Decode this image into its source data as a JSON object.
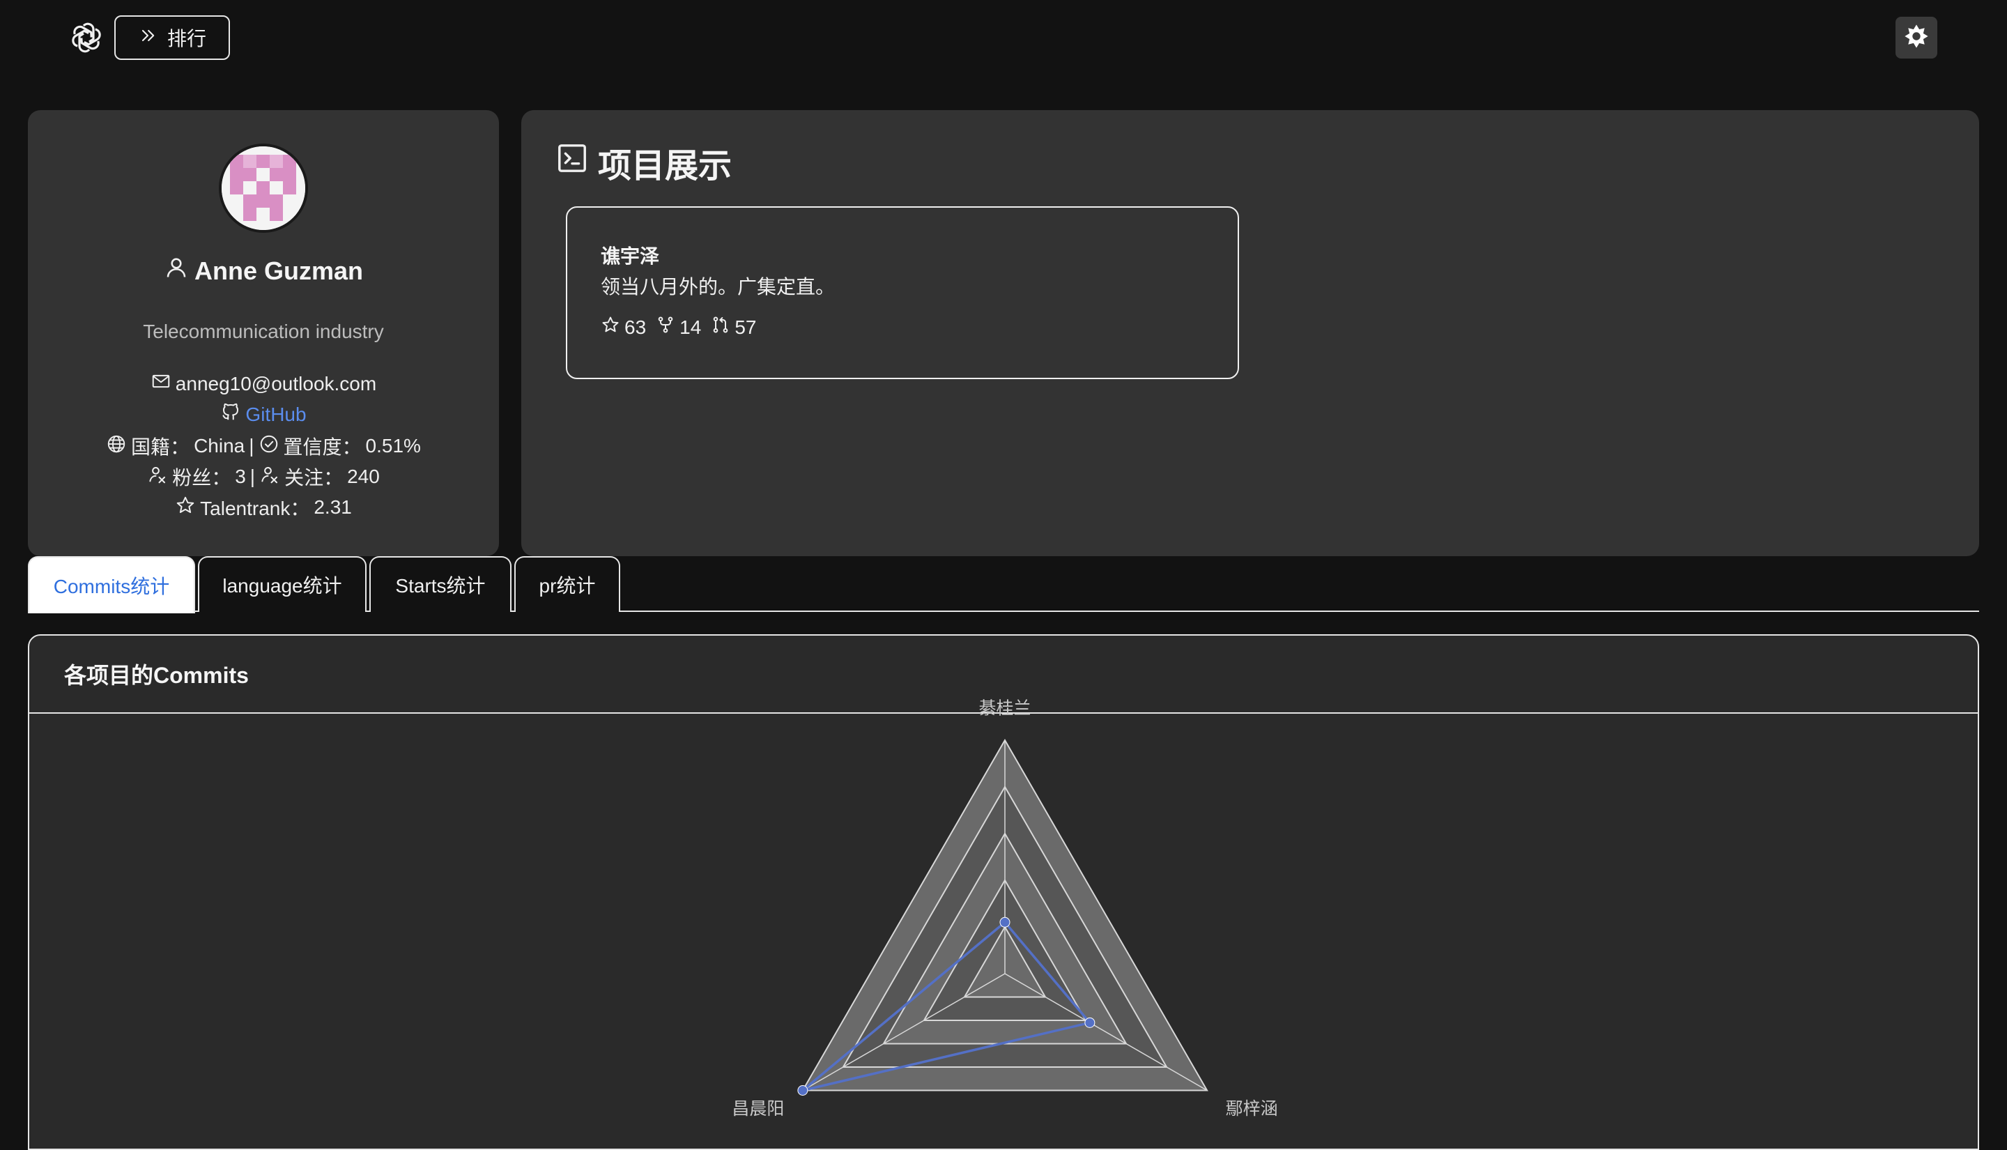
{
  "topbar": {
    "logo_icon": "openai-logo-icon",
    "rank_label": "排行",
    "rank_icon": "chevrons-right-icon",
    "theme_icon": "sun-icon"
  },
  "profile": {
    "name": "Anne Guzman",
    "company": "Telecommunication industry",
    "email": "anneg10@outlook.com",
    "github_label": "GitHub",
    "nationality_label": "国籍：",
    "nationality": "China",
    "separator": "|",
    "confidence_label": "置信度：",
    "confidence": "0.51%",
    "followers_label": "粉丝：",
    "followers": "3",
    "following_label": "关注：",
    "following": "240",
    "talentrank_label": "Talentrank：",
    "talentrank": "2.31",
    "link_color": "#5b8dee"
  },
  "projects": {
    "title": "项目展示",
    "items": [
      {
        "name": "谯宇泽",
        "description": "领当八月外的。广集定直。",
        "stars": "63",
        "forks": "14",
        "prs": "57"
      }
    ]
  },
  "tabs": [
    {
      "label": "Commits统计",
      "active": true
    },
    {
      "label": "language统计",
      "active": false
    },
    {
      "label": "Starts统计",
      "active": false
    },
    {
      "label": "pr统计",
      "active": false
    }
  ],
  "chart_panel": {
    "title": "各项目的Commits"
  },
  "chart_data": {
    "type": "radar",
    "indicators": [
      "綦桂兰",
      "鄢梓涵",
      "昌晨阳"
    ],
    "series": [
      {
        "values": [
          0.22,
          0.42,
          1.0
        ],
        "color": "#5470c6"
      }
    ],
    "rings": 5,
    "max": 1
  }
}
